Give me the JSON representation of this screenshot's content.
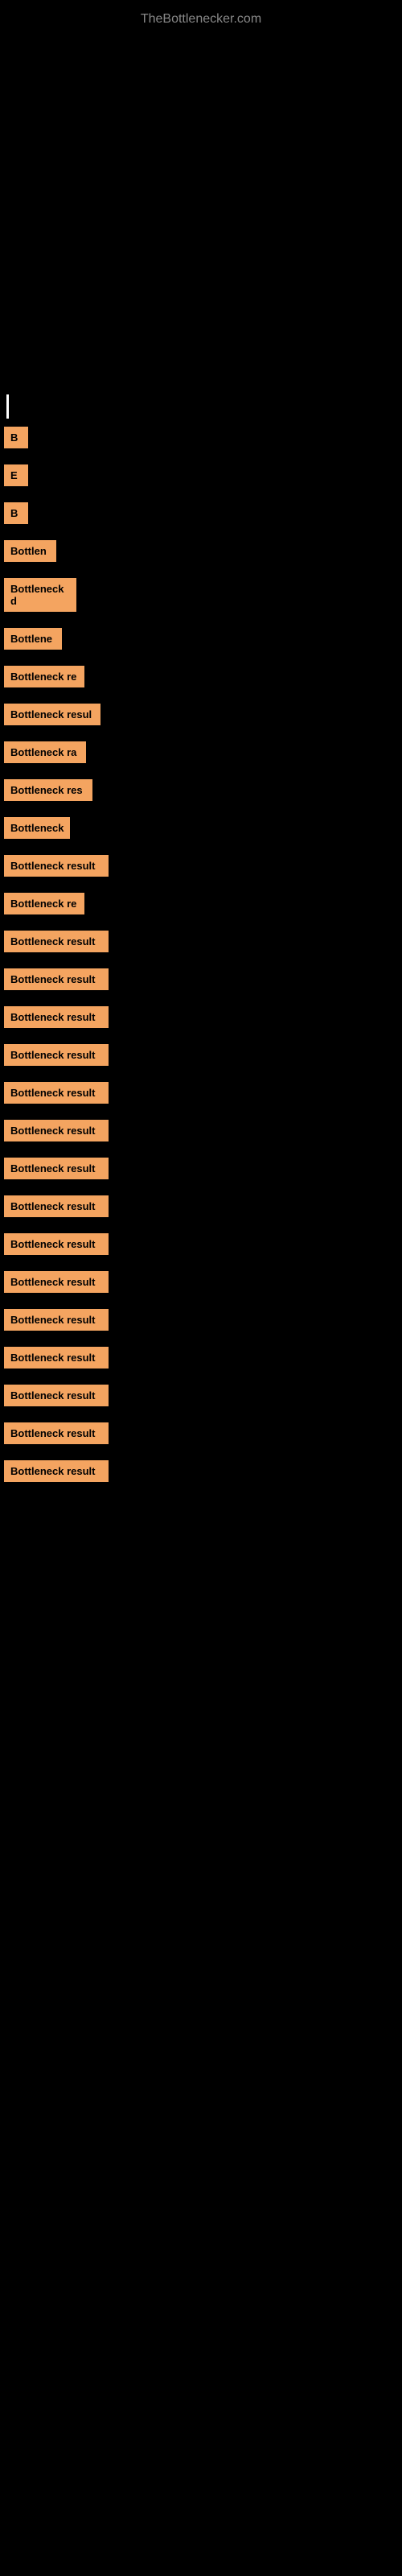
{
  "site": {
    "title": "TheBottlenecker.com"
  },
  "items": [
    {
      "id": "b1",
      "label": "B",
      "class": "item-b1"
    },
    {
      "id": "e1",
      "label": "E",
      "class": "item-e1"
    },
    {
      "id": "b2",
      "label": "B",
      "class": "item-b2"
    },
    {
      "id": "bottlen",
      "label": "Bottlen",
      "class": "item-bottlen"
    },
    {
      "id": "bottleneck-d",
      "label": "Bottleneck d",
      "class": "item-bottleneck-d"
    },
    {
      "id": "bottlene",
      "label": "Bottlene",
      "class": "item-bottlene"
    },
    {
      "id": "bottleneck-re",
      "label": "Bottleneck re",
      "class": "item-bottleneck-re"
    },
    {
      "id": "bottleneck-resul",
      "label": "Bottleneck resul",
      "class": "item-bottleneck-resul"
    },
    {
      "id": "bottleneck-ra",
      "label": "Bottleneck ra",
      "class": "item-bottleneck-ra"
    },
    {
      "id": "bottleneck-res",
      "label": "Bottleneck res",
      "class": "item-bottleneck-res"
    },
    {
      "id": "bottleneck2",
      "label": "Bottleneck",
      "class": "item-bottleneck2"
    },
    {
      "id": "bottleneck-result1",
      "label": "Bottleneck result",
      "class": "item-bottleneck-result1"
    },
    {
      "id": "bottleneck-re2",
      "label": "Bottleneck re",
      "class": "item-bottleneck-re2"
    },
    {
      "id": "bottleneck-result2",
      "label": "Bottleneck result",
      "class": "item-bottleneck-result2"
    },
    {
      "id": "bottleneck-result3",
      "label": "Bottleneck result",
      "class": "item-bottleneck-result3"
    },
    {
      "id": "bottleneck-result4",
      "label": "Bottleneck result",
      "class": "item-bottleneck-result4"
    },
    {
      "id": "bottleneck-result5",
      "label": "Bottleneck result",
      "class": "item-bottleneck-result5"
    },
    {
      "id": "bottleneck-result6",
      "label": "Bottleneck result",
      "class": "item-bottleneck-result6"
    },
    {
      "id": "bottleneck-result7",
      "label": "Bottleneck result",
      "class": "item-bottleneck-result7"
    },
    {
      "id": "bottleneck-result8",
      "label": "Bottleneck result",
      "class": "item-bottleneck-result8"
    },
    {
      "id": "bottleneck-result9",
      "label": "Bottleneck result",
      "class": "item-bottleneck-result9"
    },
    {
      "id": "bottleneck-result10",
      "label": "Bottleneck result",
      "class": "item-bottleneck-result10"
    },
    {
      "id": "bottleneck-result11",
      "label": "Bottleneck result",
      "class": "item-bottleneck-result11"
    },
    {
      "id": "bottleneck-result12",
      "label": "Bottleneck result",
      "class": "item-bottleneck-result12"
    },
    {
      "id": "bottleneck-result13",
      "label": "Bottleneck result",
      "class": "item-bottleneck-result13"
    },
    {
      "id": "bottleneck-result14",
      "label": "Bottleneck result",
      "class": "item-bottleneck-result14"
    },
    {
      "id": "bottleneck-result15",
      "label": "Bottleneck result",
      "class": "item-bottleneck-result15"
    },
    {
      "id": "bottleneck-result16",
      "label": "Bottleneck result",
      "class": "item-bottleneck-result16"
    }
  ]
}
